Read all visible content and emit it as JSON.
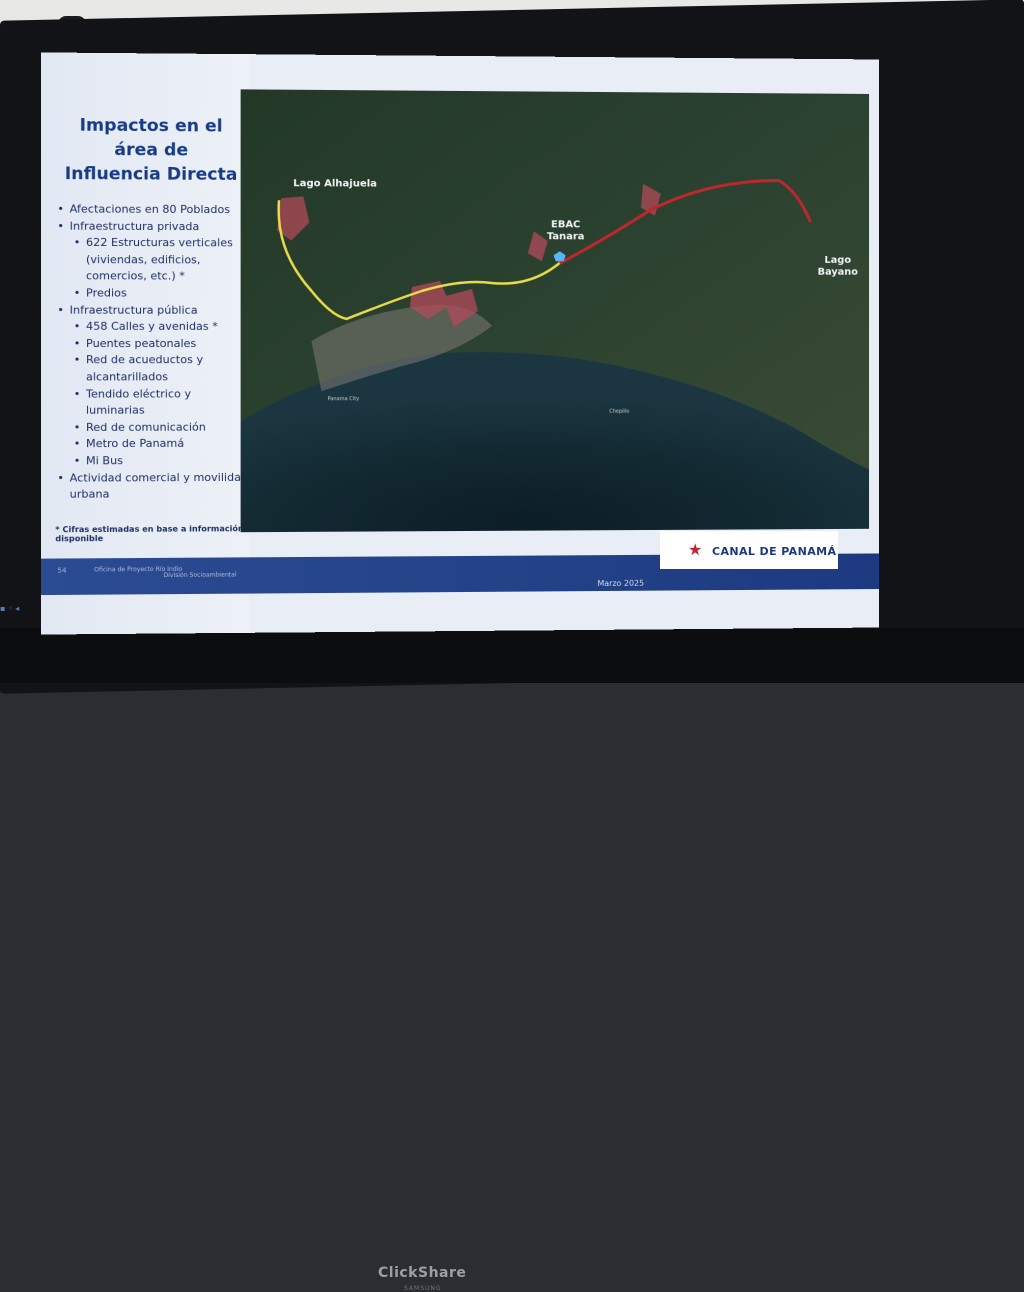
{
  "slide": {
    "title_lines": [
      "Impactos en el",
      "área de",
      "Influencia Directa"
    ],
    "bullets": [
      {
        "level": 1,
        "text": "Afectaciones en 80 Poblados"
      },
      {
        "level": 1,
        "text": "Infraestructura privada"
      },
      {
        "level": 2,
        "text": "622 Estructuras verticales (viviendas, edificios, comercios, etc.) *"
      },
      {
        "level": 2,
        "text": "Predios"
      },
      {
        "level": 1,
        "text": "Infraestructura pública"
      },
      {
        "level": 2,
        "text": "458 Calles y avenidas *"
      },
      {
        "level": 2,
        "text": "Puentes peatonales"
      },
      {
        "level": 2,
        "text": "Red de acueductos y alcantarillados"
      },
      {
        "level": 2,
        "text": "Tendido eléctrico y luminarias"
      },
      {
        "level": 2,
        "text": "Red de comunicación"
      },
      {
        "level": 2,
        "text": "Metro de Panamá"
      },
      {
        "level": 2,
        "text": "Mi Bus"
      },
      {
        "level": 1,
        "text": "Actividad comercial y movilidad urbana"
      }
    ],
    "note": "* Cifras estimadas en base a información disponible",
    "map_labels": {
      "lago_alhajuela": "Lago Alhajuela",
      "ebac_tanara": "EBAC Tanara",
      "lago_bayano": "Lago Bayano",
      "panama_city": "Panama City",
      "chepillo": "Chepillo"
    },
    "footer": {
      "page_number": "54",
      "division": "Oficina de Proyecto Río Indio",
      "section": "División Socioambiental",
      "date": "Marzo 2025"
    },
    "logo_text": "CANAL DE PANAMÁ"
  },
  "device": {
    "brand_mark": "ClickShare",
    "manufacturer": "SAMSUNG"
  },
  "colors": {
    "title_blue": "#173b86",
    "footer_blue": "#1d3a80",
    "route_yellow": "#e8dc4a",
    "route_red": "#c0262d",
    "impact_area": "#b24a5a"
  }
}
